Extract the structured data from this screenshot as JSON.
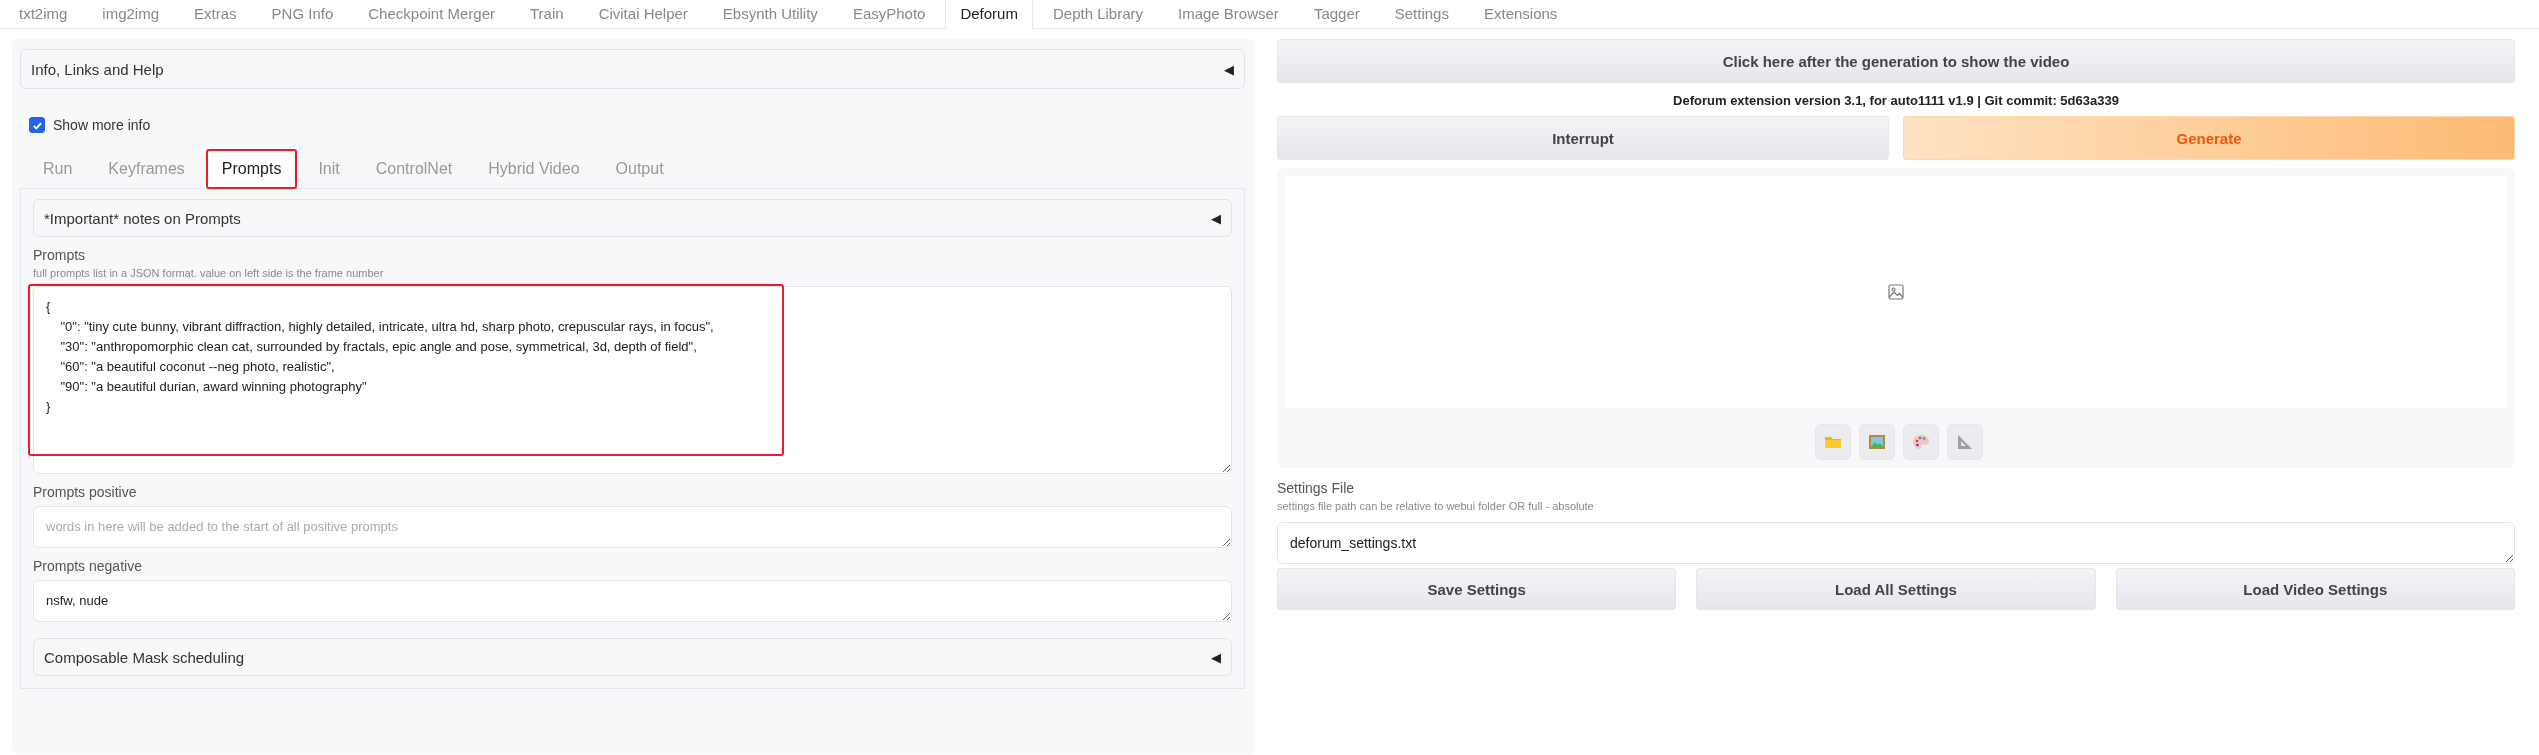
{
  "top_tabs": [
    {
      "label": "txt2img",
      "selected": false
    },
    {
      "label": "img2img",
      "selected": false
    },
    {
      "label": "Extras",
      "selected": false
    },
    {
      "label": "PNG Info",
      "selected": false
    },
    {
      "label": "Checkpoint Merger",
      "selected": false
    },
    {
      "label": "Train",
      "selected": false
    },
    {
      "label": "Civitai Helper",
      "selected": false
    },
    {
      "label": "Ebsynth Utility",
      "selected": false
    },
    {
      "label": "EasyPhoto",
      "selected": false
    },
    {
      "label": "Deforum",
      "selected": true
    },
    {
      "label": "Depth Library",
      "selected": false
    },
    {
      "label": "Image Browser",
      "selected": false
    },
    {
      "label": "Tagger",
      "selected": false
    },
    {
      "label": "Settings",
      "selected": false
    },
    {
      "label": "Extensions",
      "selected": false
    }
  ],
  "info_accordion": {
    "title": "Info, Links and Help",
    "toggle": "◀"
  },
  "show_more_info": {
    "label": "Show more info",
    "checked": true
  },
  "sub_tabs": [
    {
      "label": "Run",
      "selected": false,
      "highlighted": false
    },
    {
      "label": "Keyframes",
      "selected": false,
      "highlighted": false
    },
    {
      "label": "Prompts",
      "selected": true,
      "highlighted": true
    },
    {
      "label": "Init",
      "selected": false,
      "highlighted": false
    },
    {
      "label": "ControlNet",
      "selected": false,
      "highlighted": false
    },
    {
      "label": "Hybrid Video",
      "selected": false,
      "highlighted": false
    },
    {
      "label": "Output",
      "selected": false,
      "highlighted": false
    }
  ],
  "notes_accordion": {
    "title": "*Important* notes on Prompts",
    "toggle": "◀"
  },
  "prompts": {
    "label": "Prompts",
    "hint": "full prompts list in a JSON format. value on left side is the frame number",
    "highlighted": true,
    "value": "{\n    \"0\": \"tiny cute bunny, vibrant diffraction, highly detailed, intricate, ultra hd, sharp photo, crepuscular rays, in focus\",\n    \"30\": \"anthropomorphic clean cat, surrounded by fractals, epic angle and pose, symmetrical, 3d, depth of field\",\n    \"60\": \"a beautiful coconut --neg photo, realistic\",\n    \"90\": \"a beautiful durian, award winning photography\"\n}"
  },
  "prompts_positive": {
    "label": "Prompts positive",
    "placeholder": "words in here will be added to the start of all positive prompts"
  },
  "prompts_negative": {
    "label": "Prompts negative",
    "value": "nsfw, nude"
  },
  "mask_accordion": {
    "title": "Composable Mask scheduling",
    "toggle": "◀"
  },
  "video_button": "Click here after the generation to show the video",
  "version_text": "Deforum extension version 3.1, for auto1111 v1.9 | Git commit: 5d63a339",
  "run_buttons": [
    {
      "label": "Interrupt",
      "kind": "secondary"
    },
    {
      "label": "Generate",
      "kind": "primary"
    }
  ],
  "settings_file": {
    "label": "Settings File",
    "hint": "settings file path can be relative to webui folder OR full - absolute",
    "value": "deforum_settings.txt"
  },
  "settings_buttons": [
    "Save Settings",
    "Load All Settings",
    "Load Video Settings"
  ]
}
